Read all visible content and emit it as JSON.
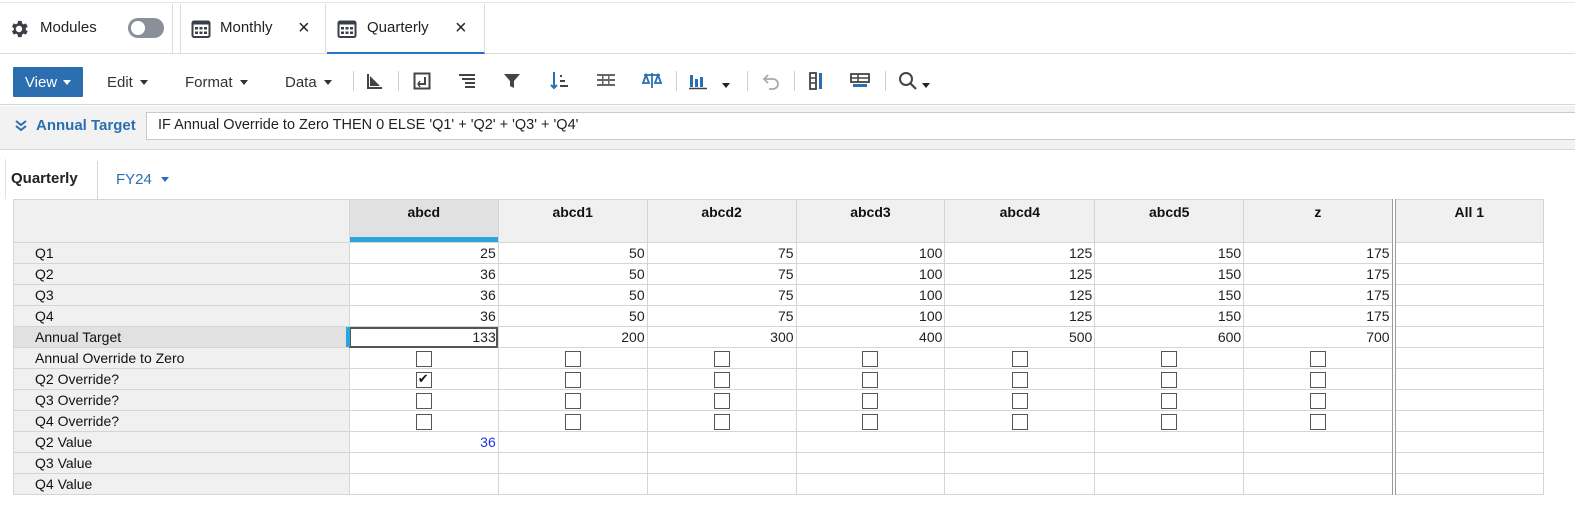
{
  "tabs": {
    "modules": {
      "label": "Modules",
      "icon": "gear-icon",
      "toggle_on": false
    },
    "monthly": {
      "label": "Monthly",
      "icon": "calendar-grid-icon",
      "close": "×"
    },
    "quarterly": {
      "label": "Quarterly",
      "icon": "calendar-grid-icon",
      "close": "×",
      "active": true
    }
  },
  "toolbar": {
    "view": "View",
    "edit": "Edit",
    "format": "Format",
    "data": "Data",
    "icons": [
      "pivot-icon",
      "insert-icon",
      "sort-rows-icon",
      "filter-icon",
      "sort-icon",
      "grid-icon",
      "balance-icon",
      "chart-icon",
      "undo-icon",
      "columns-icon",
      "table-toggle-icon",
      "search-icon"
    ]
  },
  "formula": {
    "label": "Annual Target",
    "expression": "IF Annual Override to Zero THEN 0 ELSE 'Q1' + 'Q2' + 'Q3' + 'Q4'"
  },
  "selector": {
    "title": "Quarterly",
    "period": "FY24"
  },
  "grid": {
    "columns": [
      "abcd",
      "abcd1",
      "abcd2",
      "abcd3",
      "abcd4",
      "abcd5",
      "z",
      "All 1"
    ],
    "rows": [
      {
        "label": "Q1",
        "type": "num",
        "values": [
          "25",
          "50",
          "75",
          "100",
          "125",
          "150",
          "175",
          ""
        ]
      },
      {
        "label": "Q2",
        "type": "num",
        "values": [
          "36",
          "50",
          "75",
          "100",
          "125",
          "150",
          "175",
          ""
        ]
      },
      {
        "label": "Q3",
        "type": "num",
        "values": [
          "36",
          "50",
          "75",
          "100",
          "125",
          "150",
          "175",
          ""
        ]
      },
      {
        "label": "Q4",
        "type": "num",
        "values": [
          "36",
          "50",
          "75",
          "100",
          "125",
          "150",
          "175",
          ""
        ]
      },
      {
        "label": "Annual Target",
        "type": "num",
        "active": true,
        "values": [
          "133",
          "200",
          "300",
          "400",
          "500",
          "600",
          "700",
          ""
        ]
      },
      {
        "label": "Annual Override to Zero",
        "type": "check",
        "values": [
          false,
          false,
          false,
          false,
          false,
          false,
          false,
          null
        ]
      },
      {
        "label": "Q2 Override?",
        "type": "check",
        "values": [
          true,
          false,
          false,
          false,
          false,
          false,
          false,
          null
        ]
      },
      {
        "label": "Q3 Override?",
        "type": "check",
        "values": [
          false,
          false,
          false,
          false,
          false,
          false,
          false,
          null
        ]
      },
      {
        "label": "Q4 Override?",
        "type": "check",
        "values": [
          false,
          false,
          false,
          false,
          false,
          false,
          false,
          null
        ]
      },
      {
        "label": "Q2 Value",
        "type": "num",
        "values": [
          "36",
          "",
          "",
          "",
          "",
          "",
          "",
          ""
        ]
      },
      {
        "label": "Q3 Value",
        "type": "num",
        "values": [
          "",
          "",
          "",
          "",
          "",
          "",
          "",
          ""
        ]
      },
      {
        "label": "Q4 Value",
        "type": "num",
        "values": [
          "",
          "",
          "",
          "",
          "",
          "",
          "",
          ""
        ]
      }
    ]
  },
  "colors": {
    "accent": "#2b6fb0",
    "selection": "#2aa6dc",
    "link": "#2233ee"
  }
}
